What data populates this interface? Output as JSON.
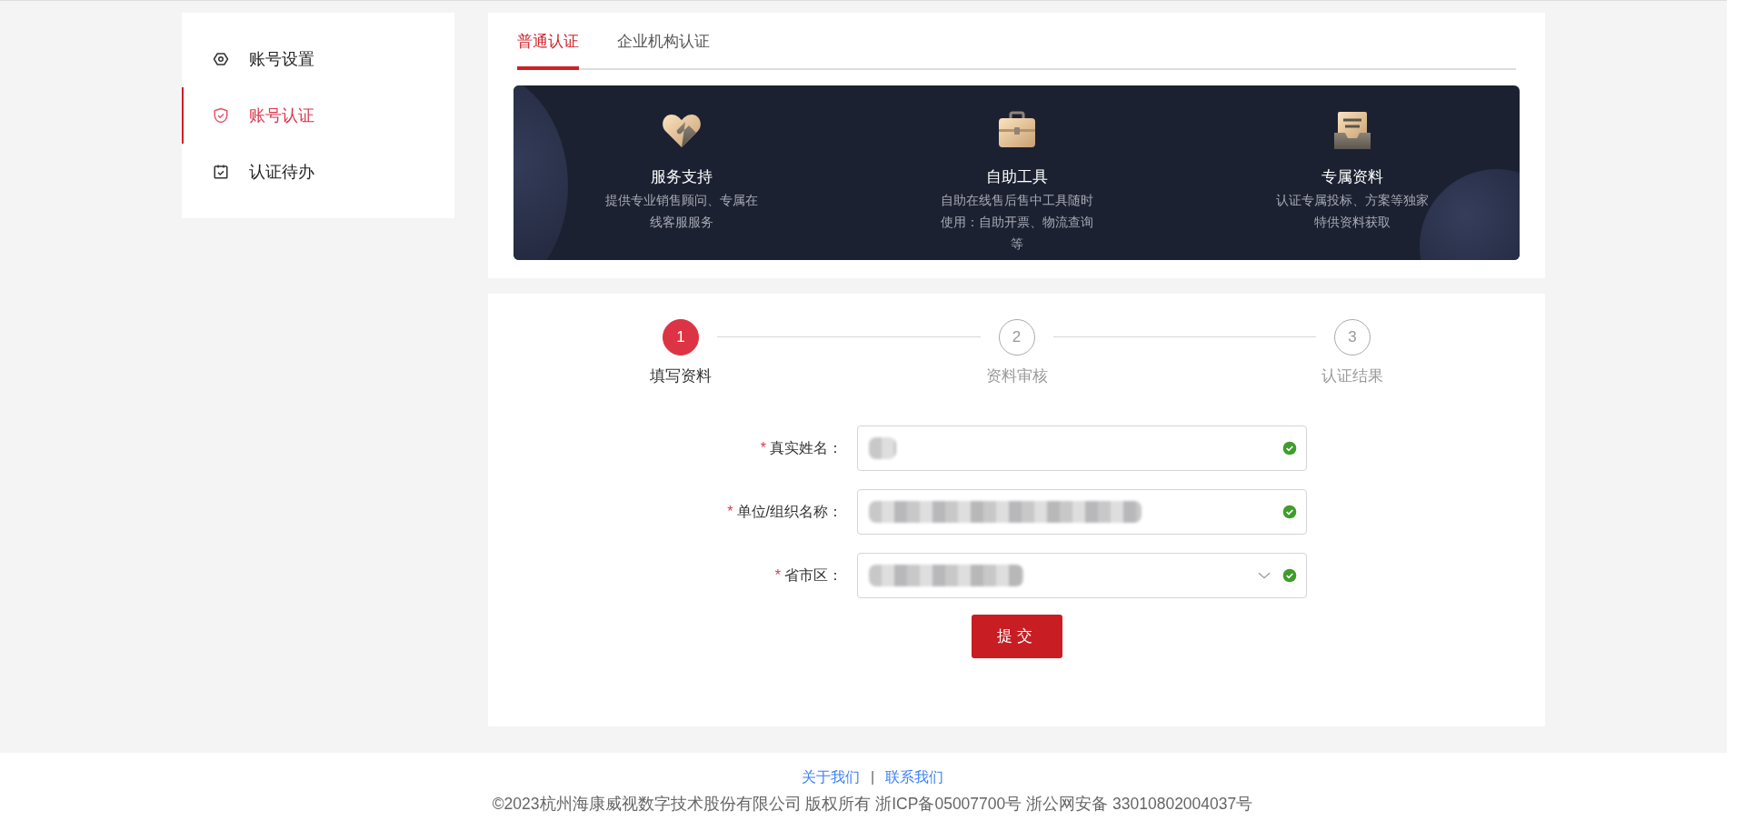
{
  "sidebar": {
    "items": [
      {
        "label": "账号设置",
        "selected": false
      },
      {
        "label": "账号认证",
        "selected": true
      },
      {
        "label": "认证待办",
        "selected": false
      }
    ]
  },
  "tabs": [
    {
      "label": "普通认证",
      "selected": true
    },
    {
      "label": "企业机构认证",
      "selected": false
    }
  ],
  "banner": {
    "features": [
      {
        "title": "服务支持",
        "description": "提供专业销售顾问、专属在线客服服务"
      },
      {
        "title": "自助工具",
        "description": "自助在线售后售中工具随时使用：自助开票、物流查询等"
      },
      {
        "title": "专属资料",
        "description": "认证专属投标、方案等独家特供资料获取"
      }
    ]
  },
  "steps": [
    {
      "number": "1",
      "label": "填写资料",
      "selected": true
    },
    {
      "number": "2",
      "label": "资料审核",
      "selected": false
    },
    {
      "number": "3",
      "label": "认证结果",
      "selected": false
    }
  ],
  "form": {
    "fields": [
      {
        "label": "真实姓名：",
        "required_mark": "*",
        "kind": "text",
        "valid": true
      },
      {
        "label": "单位/组织名称：",
        "required_mark": "*",
        "kind": "text",
        "valid": true
      },
      {
        "label": "省市区：",
        "required_mark": "*",
        "kind": "select",
        "valid": true
      }
    ],
    "submit": "提交"
  },
  "footer": {
    "links": [
      "关于我们",
      "联系我们"
    ],
    "separator": "|",
    "copyright": "©2023杭州海康威视数字技术股份有限公司 版权所有 浙ICP备05007700号 浙公网安备 33010802004037号"
  }
}
